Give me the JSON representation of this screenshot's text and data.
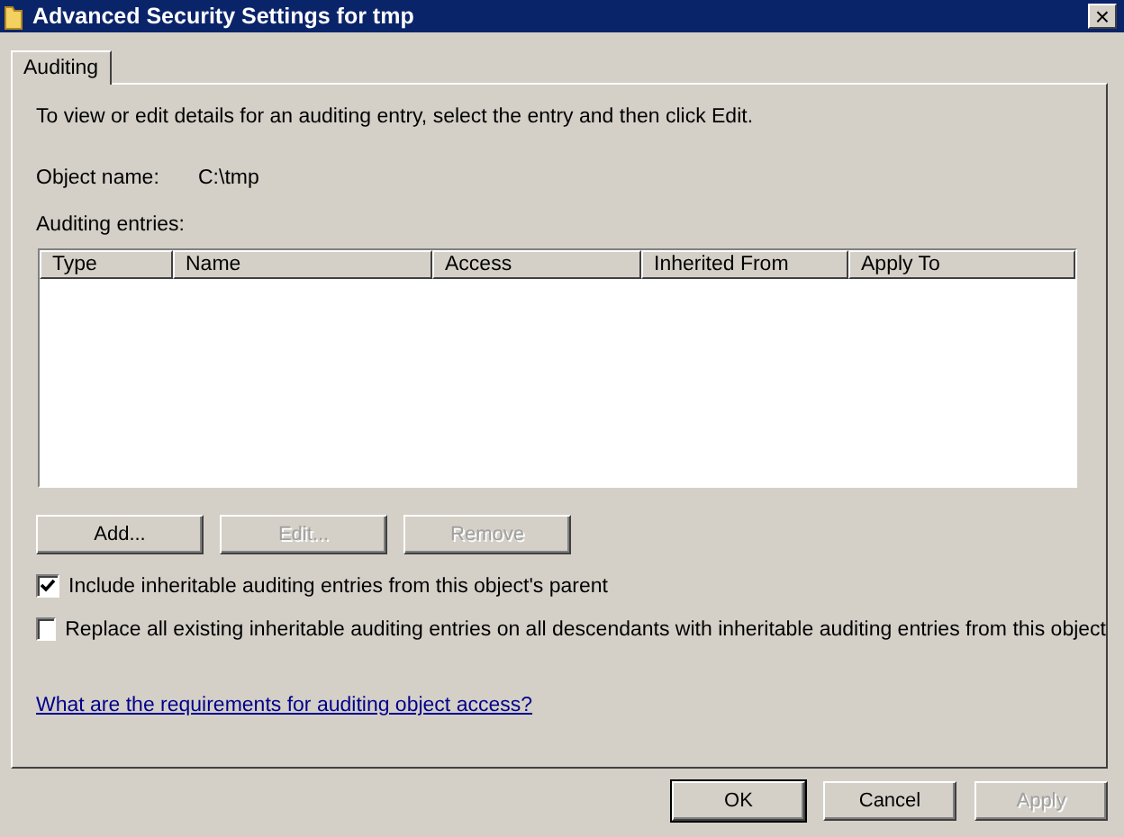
{
  "window": {
    "title": "Advanced Security Settings for tmp",
    "close": "×"
  },
  "tabs": [
    {
      "label": "Auditing",
      "selected": true
    }
  ],
  "instructions": "To view or edit details for an auditing entry, select the entry and then click Edit.",
  "object_name": {
    "label": "Object name:",
    "value": "C:\\tmp"
  },
  "entries_label": "Auditing entries:",
  "table": {
    "columns": [
      "Type",
      "Name",
      "Access",
      "Inherited From",
      "Apply To"
    ]
  },
  "entry_buttons": [
    {
      "label": "Add...",
      "disabled": false
    },
    {
      "label": "Edit...",
      "disabled": true
    },
    {
      "label": "Remove",
      "disabled": true
    }
  ],
  "options": [
    {
      "label": "Include inheritable auditing entries from this object's parent",
      "checked": true
    },
    {
      "label": "Replace all existing inheritable auditing entries on all descendants with inheritable auditing entries from this object",
      "checked": false
    }
  ],
  "help_link": "What are the requirements for auditing object access?",
  "dialog_buttons": [
    {
      "label": "OK",
      "disabled": false,
      "default": true
    },
    {
      "label": "Cancel",
      "disabled": false,
      "default": false
    },
    {
      "label": "Apply",
      "disabled": true,
      "default": false
    }
  ]
}
